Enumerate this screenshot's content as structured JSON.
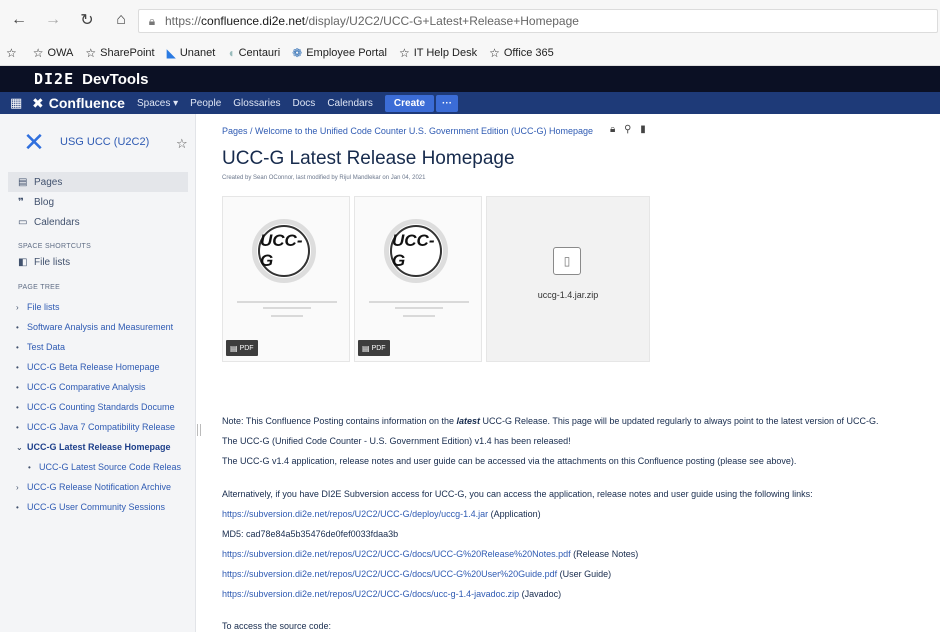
{
  "browser": {
    "url_prefix": "https://",
    "url_host": "confluence.di2e.net",
    "url_path": "/display/U2C2/UCC-G+Latest+Release+Homepage",
    "favorites": [
      {
        "label": "OWA",
        "icon": "star-icon"
      },
      {
        "label": "SharePoint",
        "icon": "star-icon"
      },
      {
        "label": "Unanet",
        "icon": "unanet-icon"
      },
      {
        "label": "Centauri",
        "icon": "centauri-icon"
      },
      {
        "label": "Employee Portal",
        "icon": "portal-icon"
      },
      {
        "label": "IT Help Desk",
        "icon": "star-icon"
      },
      {
        "label": "Office 365",
        "icon": "star-icon"
      }
    ]
  },
  "devtools": {
    "logo": "DI2E",
    "title": "DevTools"
  },
  "nav": {
    "brand": "Confluence",
    "spaces": "Spaces ▾",
    "people": "People",
    "glossaries": "Glossaries",
    "docs": "Docs",
    "calendars": "Calendars",
    "create": "Create",
    "more": "···"
  },
  "sidebar": {
    "space_name": "USG UCC (U2C2)",
    "items": [
      {
        "label": "Pages",
        "icon": "pages-icon"
      },
      {
        "label": "Blog",
        "icon": "blog-icon"
      },
      {
        "label": "Calendars",
        "icon": "calendar-icon"
      }
    ],
    "shortcuts_heading": "SPACE SHORTCUTS",
    "shortcut": "File lists",
    "tree_heading": "PAGE TREE",
    "tree": [
      {
        "mark": "›",
        "label": "File lists"
      },
      {
        "mark": "•",
        "label": "Software Analysis and Measurement"
      },
      {
        "mark": "•",
        "label": "Test Data"
      },
      {
        "mark": "•",
        "label": "UCC-G Beta Release Homepage"
      },
      {
        "mark": "•",
        "label": "UCC-G Comparative Analysis"
      },
      {
        "mark": "•",
        "label": "UCC-G Counting Standards Docume"
      },
      {
        "mark": "•",
        "label": "UCC-G Java 7 Compatibility Release"
      },
      {
        "mark": "⌄",
        "label": "UCC-G Latest Release Homepage"
      },
      {
        "mark": "•",
        "label": "UCC-G Latest Source Code Releas"
      },
      {
        "mark": "›",
        "label": "UCC-G Release Notification Archive"
      },
      {
        "mark": "•",
        "label": "UCC-G User Community Sessions"
      }
    ]
  },
  "main": {
    "breadcrumb": "Pages  /  Welcome to the Unified Code Counter U.S. Government Edition (UCC-G) Homepage",
    "title": "UCC-G Latest Release Homepage",
    "byline": "Created by Sean OConnor, last modified by Rijul Mandlekar on Jan 04, 2021",
    "attachments": {
      "seal_text": "UCC-G",
      "pdf_label": "PDF",
      "zip_name": "uccg-1.4.jar.zip"
    },
    "note_prefix": "Note: This Confluence Posting contains information on the ",
    "note_emph": "latest",
    "note_suffix": " UCC-G Release.  This page will be updated regularly to always point to the latest version of UCC-G.",
    "released": "The UCC-G (Unified Code Counter - U.S. Government Edition) v1.4 has been released!",
    "access": "The UCC-G v1.4 application, release notes and user guide can be accessed via the attachments on this Confluence posting (please see above).",
    "alternatively": "Alternatively, if you have DI2E Subversion access for UCC-G, you can access the application, release notes and user guide using the following links:",
    "link_jar": "https://subversion.di2e.net/repos/U2C2/UCC-G/deploy/uccg-1.4.jar",
    "link_jar_note": "  (Application)",
    "md5": "MD5: cad78e84a5b35476de0fef0033fdaa3b",
    "link_notes": "https://subversion.di2e.net/repos/U2C2/UCC-G/docs/UCC-G%20Release%20Notes.pdf",
    "link_notes_note": " (Release Notes)",
    "link_guide": "https://subversion.di2e.net/repos/U2C2/UCC-G/docs/UCC-G%20User%20Guide.pdf",
    "link_guide_note": " (User Guide)",
    "link_javadoc": "https://subversion.di2e.net/repos/U2C2/UCC-G/docs/ucc-g-1.4-javadoc.zip",
    "link_javadoc_note": " (Javadoc)",
    "source": "To access the source code:"
  }
}
